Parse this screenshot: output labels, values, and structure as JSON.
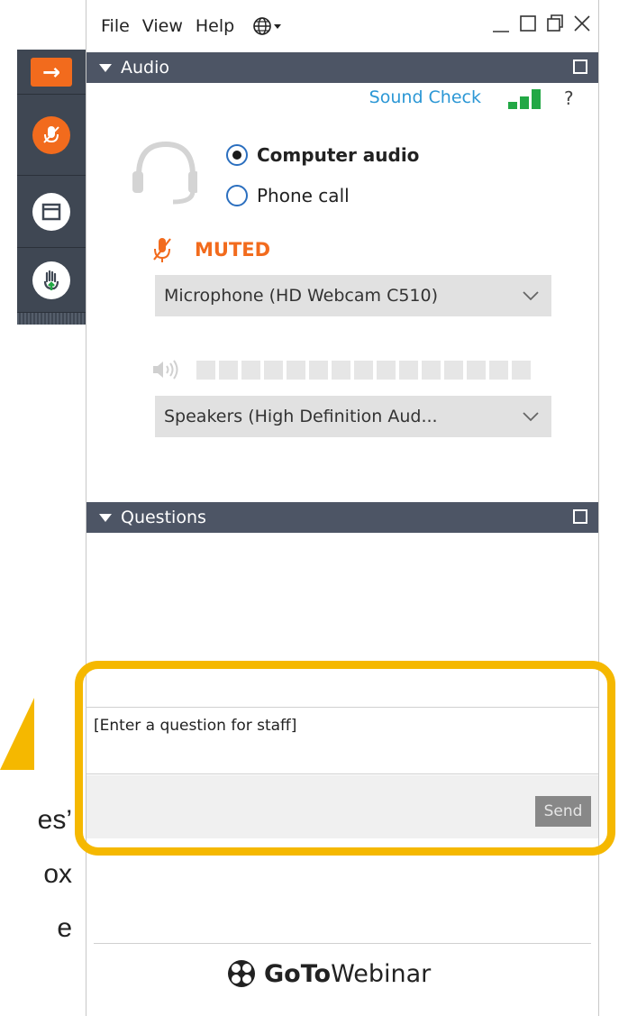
{
  "menubar": {
    "items": [
      "File",
      "View",
      "Help"
    ],
    "globe_icon": "globe-icon"
  },
  "window_controls": [
    "minimize-icon",
    "maximize-icon",
    "restore-icon",
    "close-icon"
  ],
  "audio_panel": {
    "title": "Audio",
    "sound_check_label": "Sound Check",
    "help_label": "?",
    "options": [
      {
        "label": "Computer audio",
        "selected": true
      },
      {
        "label": "Phone call",
        "selected": false
      }
    ],
    "muted_label": "MUTED",
    "microphone_select": "Microphone (HD Webcam C510)",
    "speaker_select": "Speakers (High Definition Aud..."
  },
  "questions_panel": {
    "title": "Questions",
    "input_text": "[Enter a question for staff]",
    "send_label": "Send"
  },
  "branding": {
    "logo_bold": "GoTo",
    "logo_regular": "Webinar"
  },
  "annotation": {
    "lines": [
      "es’",
      "ox",
      "e"
    ]
  },
  "colors": {
    "accent_orange": "#f26b1d",
    "header_bg": "#4d5565",
    "link_blue": "#2b97d5",
    "signal_green": "#22a845",
    "highlight_yellow": "#f5b800"
  }
}
